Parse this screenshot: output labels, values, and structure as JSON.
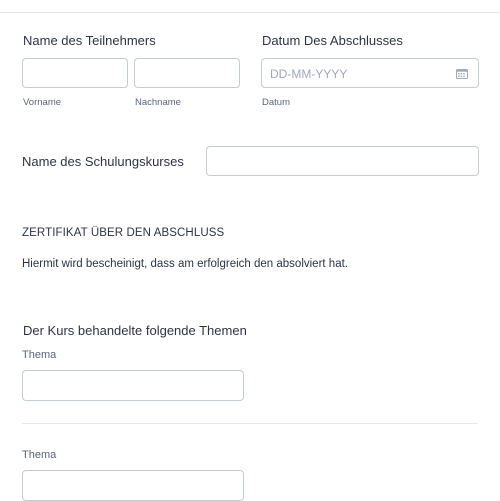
{
  "participant": {
    "label": "Name des Teilnehmers",
    "first_sublabel": "Vorname",
    "last_sublabel": "Nachname",
    "first_value": "",
    "last_value": ""
  },
  "completion_date": {
    "label": "Datum Des Abschlusses",
    "placeholder": "DD-MM-YYYY",
    "sublabel": "Datum",
    "icon": "calendar-icon"
  },
  "course": {
    "label": "Name des Schulungskurses",
    "value": ""
  },
  "certificate": {
    "heading": "ZERTIFIKAT ÜBER DEN ABSCHLUSS",
    "text": "Hiermit wird bescheinigt, dass am erfolgreich den absolviert hat."
  },
  "topics": {
    "heading": "Der Kurs behandelte folgende Themen",
    "items": [
      {
        "label": "Thema",
        "value": ""
      },
      {
        "label": "Thema",
        "value": ""
      }
    ]
  },
  "colors": {
    "border": "#c3cad8",
    "text": "#2c3345",
    "sublabel": "#57647e",
    "placeholder": "#a0a8b8"
  }
}
